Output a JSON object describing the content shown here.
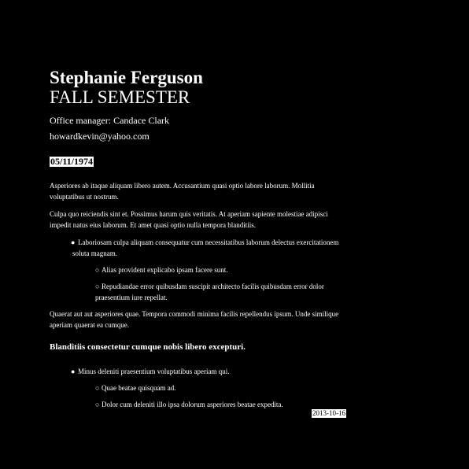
{
  "header": {
    "name": "Stephanie Ferguson",
    "subtitle": "FALL SEMESTER",
    "office_manager": "Office manager: Candace Clark",
    "email": "howardkevin@yahoo.com",
    "date": "05/11/1974"
  },
  "body": {
    "para1": "Asperiores ab itaque aliquam libero autem. Accusantium quasi optio labore laborum. Mollitia voluptatibus ut nostrum.",
    "para2": "Culpa quo reiciendis sint et. Possimus harum quis veritatis. At aperiam sapiente molestiae adipisci impedit natus eius laborum. Et amet quasi optio nulla tempora blanditiis.",
    "list1": {
      "item1": "Laboriosam culpa aliquam consequatur cum necessitatibus laborum delectus exercitationem soluta magnam.",
      "sub1": "Alias provident explicabo ipsam facere sunt.",
      "sub2": "Repudiandae error quibusdam suscipit architecto facilis quibusdam error dolor praesentium iure repellat."
    },
    "para3": "Quaerat aut aut asperiores quae. Tempora commodi minima facilis repellendus ipsum. Unde similique aperiam quaerat ea cumque.",
    "heading": "Blanditiis consectetur cumque nobis libero excepturi.",
    "list2": {
      "item1": "Minus deleniti praesentium voluptatibus aperiam qui.",
      "sub1": "Quae beatae quisquam ad.",
      "sub2": "Dolor cum deleniti illo ipsa dolorum asperiores beatae expedita."
    }
  },
  "footer": {
    "date": "2013-10-16"
  },
  "bullets": {
    "filled": "●",
    "hollow": "○"
  },
  "colors": {
    "background": "#000000",
    "text": "#ffffff"
  }
}
